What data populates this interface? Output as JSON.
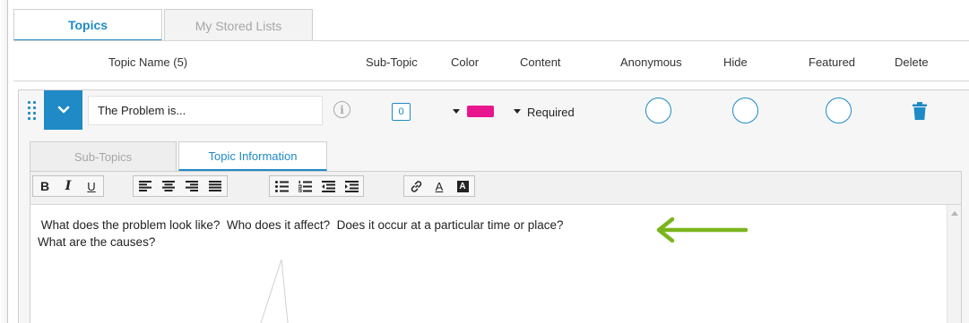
{
  "tabs": [
    {
      "label": "Topics",
      "active": true
    },
    {
      "label": "My Stored Lists",
      "active": false
    }
  ],
  "columns": {
    "topic_name": "Topic Name (5)",
    "sub_topic": "Sub-Topic",
    "color": "Color",
    "content": "Content",
    "anonymous": "Anonymous",
    "hide": "Hide",
    "featured": "Featured",
    "delete": "Delete"
  },
  "topic": {
    "name": "The Problem is...",
    "sub_topic_count": "0",
    "color": "#e8168f",
    "content": "Required",
    "anonymous": false,
    "hide": false,
    "featured": false
  },
  "inner_tabs": [
    {
      "label": "Sub-Topics",
      "active": false
    },
    {
      "label": "Topic Information",
      "active": true
    }
  ],
  "toolbar": {
    "bold": "B",
    "italic": "I",
    "underline": "U",
    "font_color": "A",
    "background_color": "A"
  },
  "editor": {
    "line1": " What does the problem look like?  Who does it affect?  Does it occur at a particular time or place?",
    "line2": "What are the causes?"
  },
  "icons": {
    "drag": "drag-handle-icon",
    "expand": "chevron-down-icon",
    "info": "info-icon",
    "delete": "trash-icon",
    "link": "link-icon"
  },
  "colors": {
    "accent": "#1f8ac6",
    "annotation_arrow": "#7ab51d",
    "topic_color": "#e8168f"
  }
}
